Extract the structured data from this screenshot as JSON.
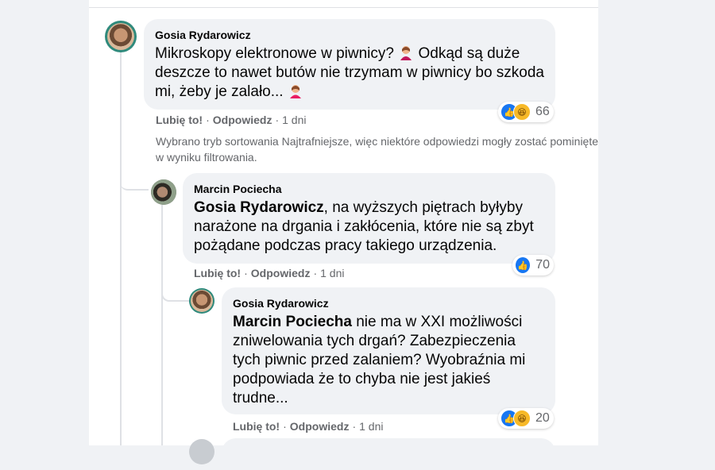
{
  "comments": [
    {
      "author": "Gosia Rydarowicz",
      "mention": "",
      "text_before_emoji": "Mikroskopy elektronowe w piwnicy? ",
      "text_after_emoji": " Odkąd są duże deszcze to nawet butów nie trzymam w piwnicy bo szkoda mi, żeby je zalało... ",
      "reaction_count": "66",
      "reactions": [
        "like-icon",
        "haha-icon"
      ],
      "like_label": "Lubię to!",
      "reply_label": "Odpowiedz",
      "separator": "·",
      "time": "1 dni"
    },
    {
      "author": "Marcin Pociecha",
      "mention": "Gosia Rydarowicz",
      "text": ", na wyższych piętrach byłyby narażone na drgania i zakłócenia, które nie są zbyt pożądane podczas pracy takiego urządzenia.",
      "reaction_count": "70",
      "reactions": [
        "like-icon"
      ],
      "like_label": "Lubię to!",
      "reply_label": "Odpowiedz",
      "separator": "·",
      "time": "1 dni"
    },
    {
      "author": "Gosia Rydarowicz",
      "mention": "Marcin Pociecha",
      "text": " nie ma w XXI możliwości zniwelowania tych drgań? Zabezpieczenia tych piwnic przed zalaniem? Wyobraźnia mi podpowiada że to chyba nie jest jakieś trudne...",
      "reaction_count": "20",
      "reactions": [
        "like-icon",
        "haha-icon"
      ],
      "like_label": "Lubię to!",
      "reply_label": "Odpowiedz",
      "separator": "·",
      "time": "1 dni"
    }
  ],
  "filter_notice": "Wybrano tryb sortowania Najtrafniejsze, więc niektóre odpowiedzi mogły zostać pominięte w wyniku filtrowania.",
  "colors": {
    "like": "#1877f2",
    "haha": "#f7b928",
    "bubble": "#f0f2f5",
    "muted_text": "#65676b",
    "avatar_ring": "#2f8a7c"
  }
}
